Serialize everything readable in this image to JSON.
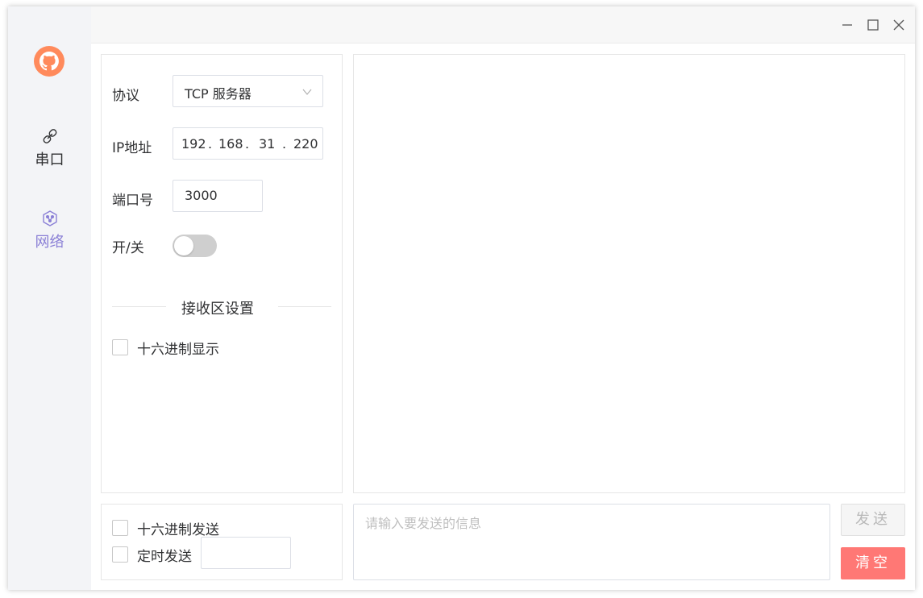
{
  "nav": {
    "items": [
      {
        "label": "串口",
        "icon": "link-icon"
      },
      {
        "label": "网络",
        "icon": "network-hexagon-icon",
        "active": true
      }
    ],
    "logo_icon": "github-icon",
    "active_color": "#8a7fd6"
  },
  "window_controls": [
    "minimize-icon",
    "maximize-icon",
    "close-icon"
  ],
  "settings": {
    "protocol_label": "协议",
    "protocol_value": "TCP 服务器",
    "ip_label": "IP地址",
    "ip_segments": [
      "192",
      "168",
      "31",
      "220"
    ],
    "port_label": "端口号",
    "port_value": "3000",
    "toggle_label": "开/关",
    "toggle_on": false,
    "receive_section_title": "接收区设置",
    "hex_display_label": "十六进制显示"
  },
  "send_options": {
    "hex_send_label": "十六进制发送",
    "timed_send_label": "定时发送",
    "interval_value": ""
  },
  "composer": {
    "placeholder": "请输入要发送的信息",
    "send_label": "发送",
    "clear_label": "清空",
    "clear_color": "#ff7875"
  }
}
